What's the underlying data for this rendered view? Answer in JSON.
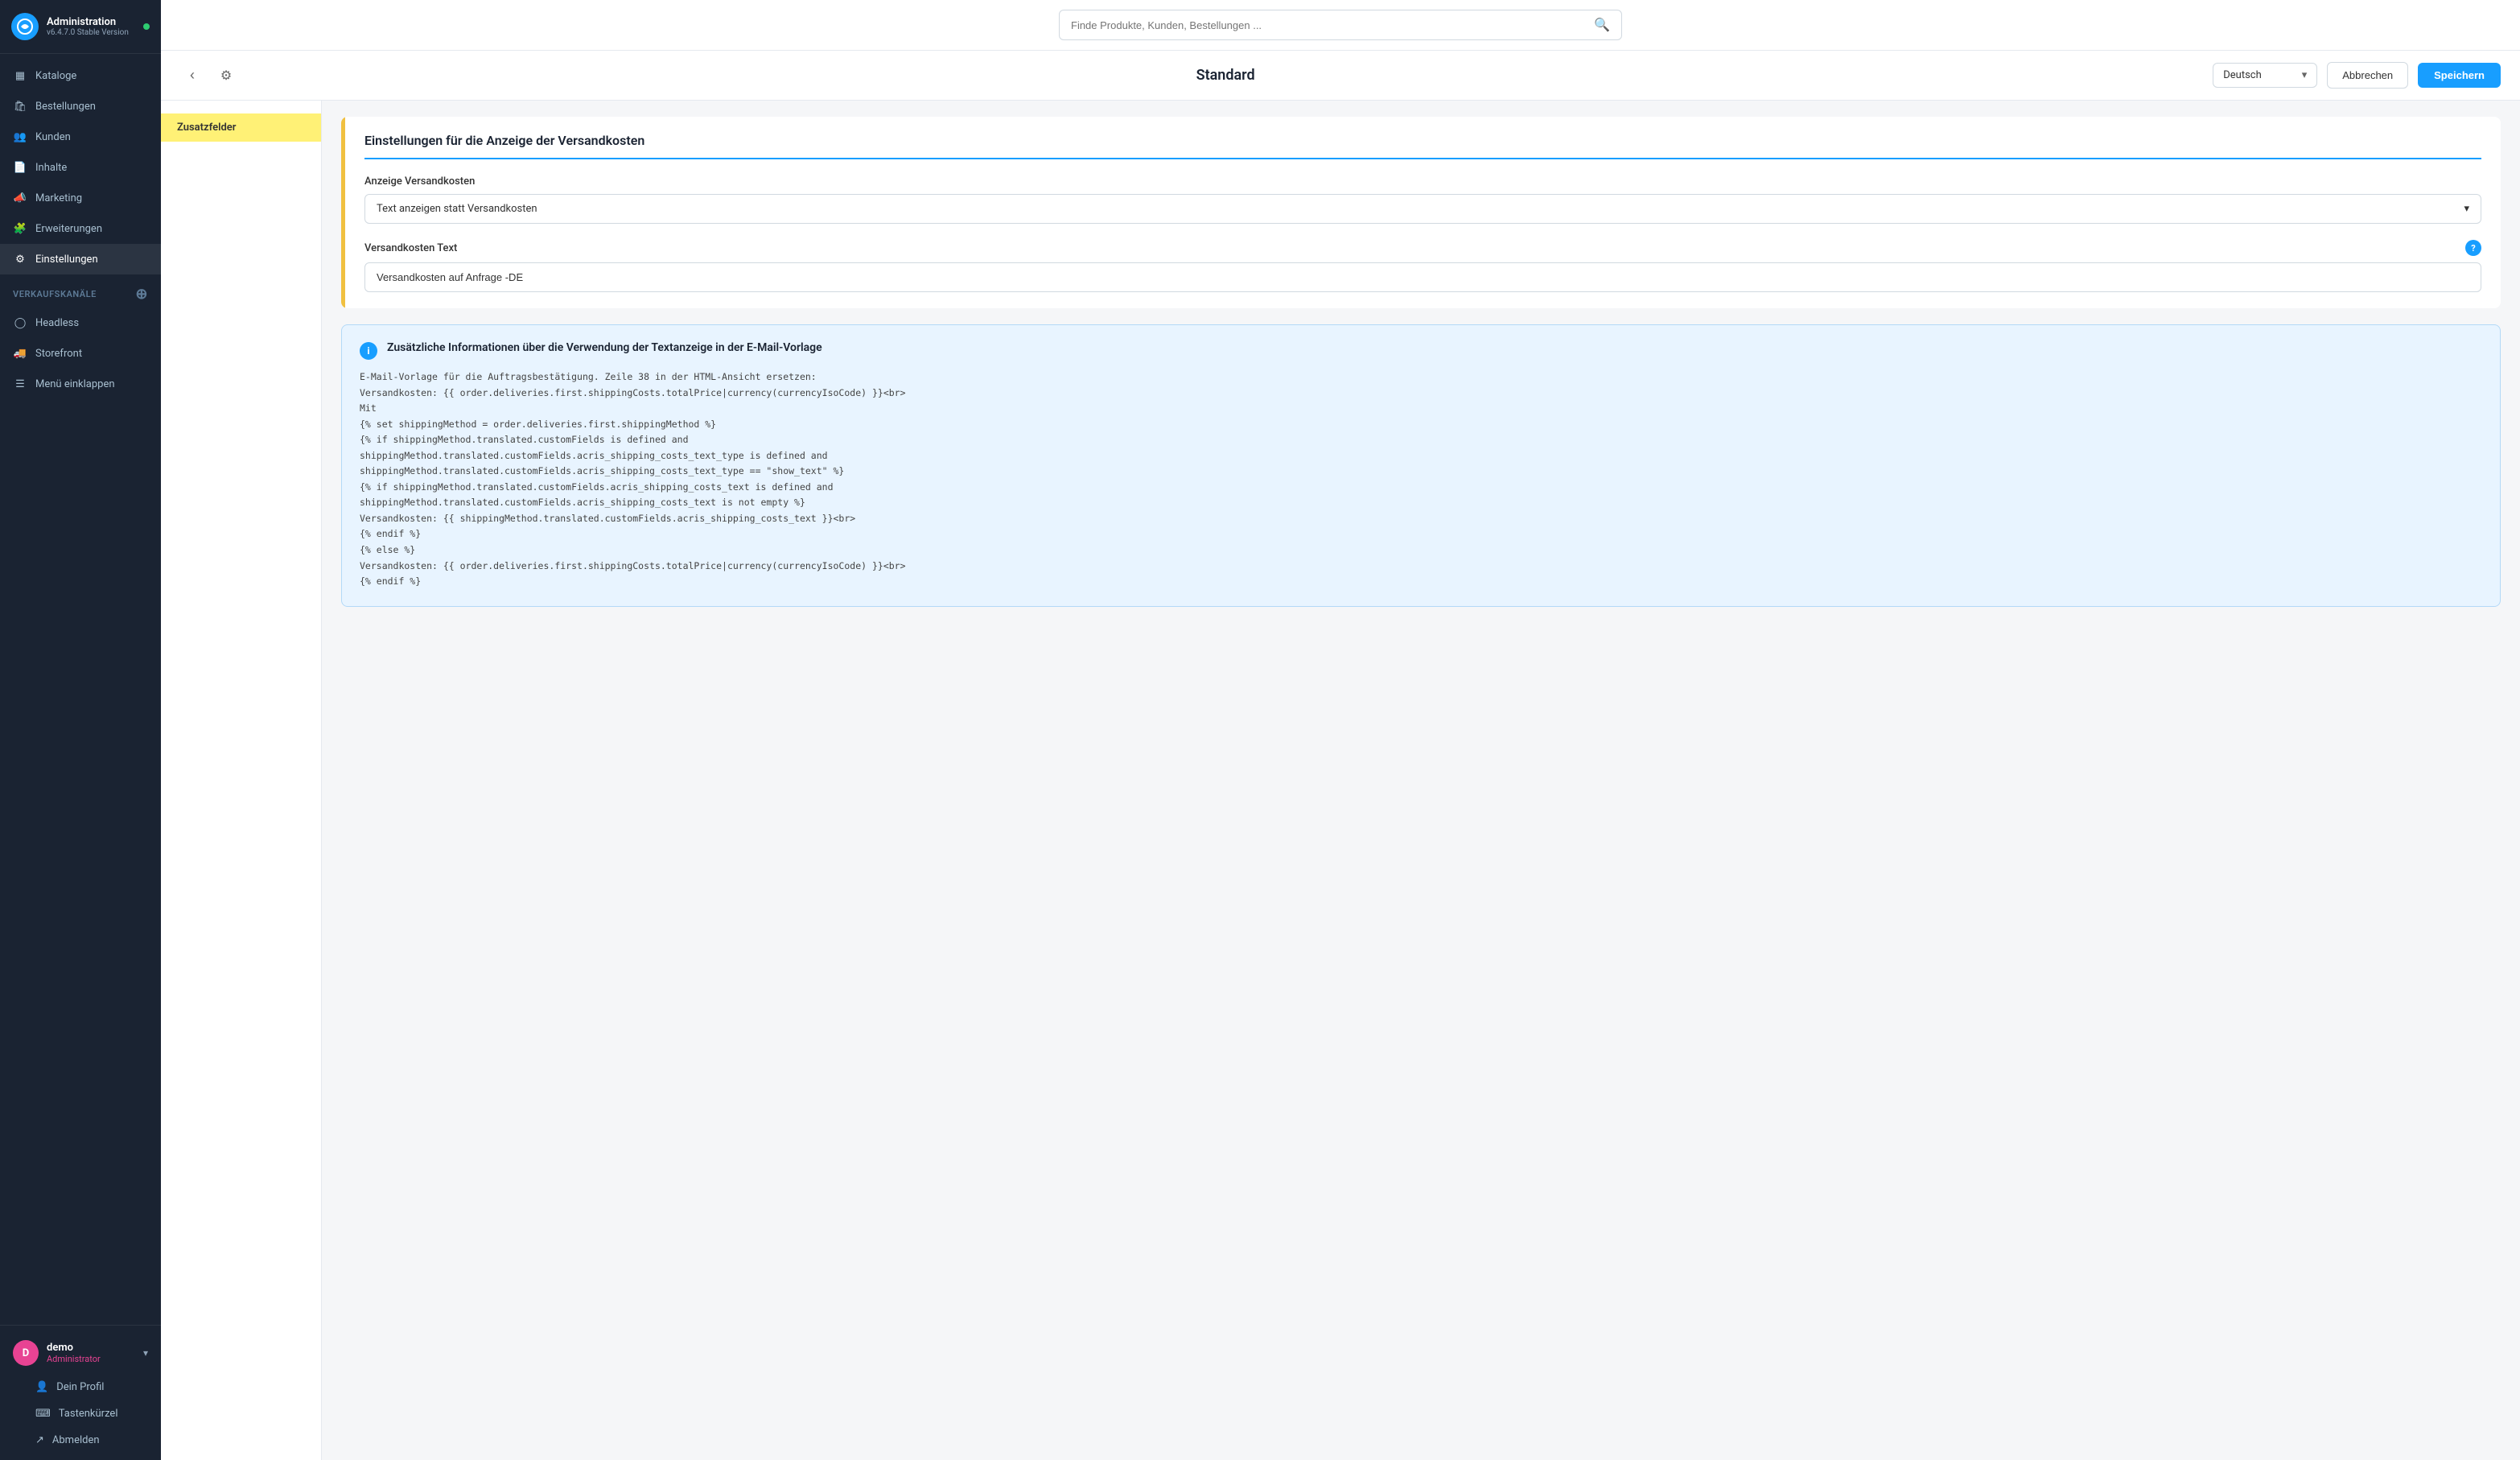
{
  "app": {
    "title": "Administration",
    "version": "v6.4.7.0 Stable Version",
    "logo_letter": "G"
  },
  "sidebar": {
    "nav_items": [
      {
        "id": "kataloge",
        "label": "Kataloge",
        "icon": "grid"
      },
      {
        "id": "bestellungen",
        "label": "Bestellungen",
        "icon": "bag"
      },
      {
        "id": "kunden",
        "label": "Kunden",
        "icon": "users"
      },
      {
        "id": "inhalte",
        "label": "Inhalte",
        "icon": "file"
      },
      {
        "id": "marketing",
        "label": "Marketing",
        "icon": "megaphone"
      },
      {
        "id": "erweiterungen",
        "label": "Erweiterungen",
        "icon": "puzzle"
      },
      {
        "id": "einstellungen",
        "label": "Einstellungen",
        "icon": "gear",
        "active": true
      }
    ],
    "verkaufskanaele_section": "Verkaufskanäle",
    "verkaufskanaele_items": [
      {
        "id": "headless",
        "label": "Headless",
        "icon": "circle"
      },
      {
        "id": "storefront",
        "label": "Storefront",
        "icon": "truck"
      }
    ],
    "collapse_label": "Menü einklappen",
    "user": {
      "initial": "D",
      "name": "demo",
      "role": "Administrator"
    },
    "user_menu": [
      {
        "id": "profil",
        "label": "Dein Profil",
        "icon": "person"
      },
      {
        "id": "tastenkuerzel",
        "label": "Tastenkürzel",
        "icon": "keyboard"
      },
      {
        "id": "abmelden",
        "label": "Abmelden",
        "icon": "logout"
      }
    ]
  },
  "topbar": {
    "search_placeholder": "Finde Produkte, Kunden, Bestellungen ..."
  },
  "header": {
    "title": "Standard",
    "language": "Deutsch",
    "cancel_label": "Abbrechen",
    "save_label": "Speichern"
  },
  "left_panel": {
    "items": [
      {
        "id": "zusatzfelder",
        "label": "Zusatzfelder",
        "highlighted": true
      }
    ]
  },
  "form": {
    "section_title": "Einstellungen für die Anzeige der Versandkosten",
    "anzeige_label": "Anzeige Versandkosten",
    "anzeige_value": "Text anzeigen statt Versandkosten",
    "versandkosten_text_label": "Versandkosten Text",
    "versandkosten_text_value": "Versandkosten auf Anfrage -DE",
    "info_box": {
      "title": "Zusätzliche Informationen über die Verwendung der Textanzeige in der E-Mail-Vorlage",
      "lines": [
        "E-Mail-Vorlage für die Auftragsbestätigung. Zeile 38 in der HTML-Ansicht ersetzen:",
        "Versandkosten: {{ order.deliveries.first.shippingCosts.totalPrice|currency(currencyIsoCode) }}<br>",
        "Mit",
        "{% set shippingMethod = order.deliveries.first.shippingMethod %}",
        "{% if shippingMethod.translated.customFields is defined and",
        "shippingMethod.translated.customFields.acris_shipping_costs_text_type is defined and",
        "shippingMethod.translated.customFields.acris_shipping_costs_text_type == \"show_text\" %}",
        "{% if shippingMethod.translated.customFields.acris_shipping_costs_text is defined and",
        "shippingMethod.translated.customFields.acris_shipping_costs_text is not empty %}",
        "Versandkosten: {{ shippingMethod.translated.customFields.acris_shipping_costs_text }}<br>",
        "{% endif %}",
        "{% else %}",
        "Versandkosten: {{ order.deliveries.first.shippingCosts.totalPrice|currency(currencyIsoCode) }}<br>",
        "{% endif %}"
      ]
    }
  }
}
